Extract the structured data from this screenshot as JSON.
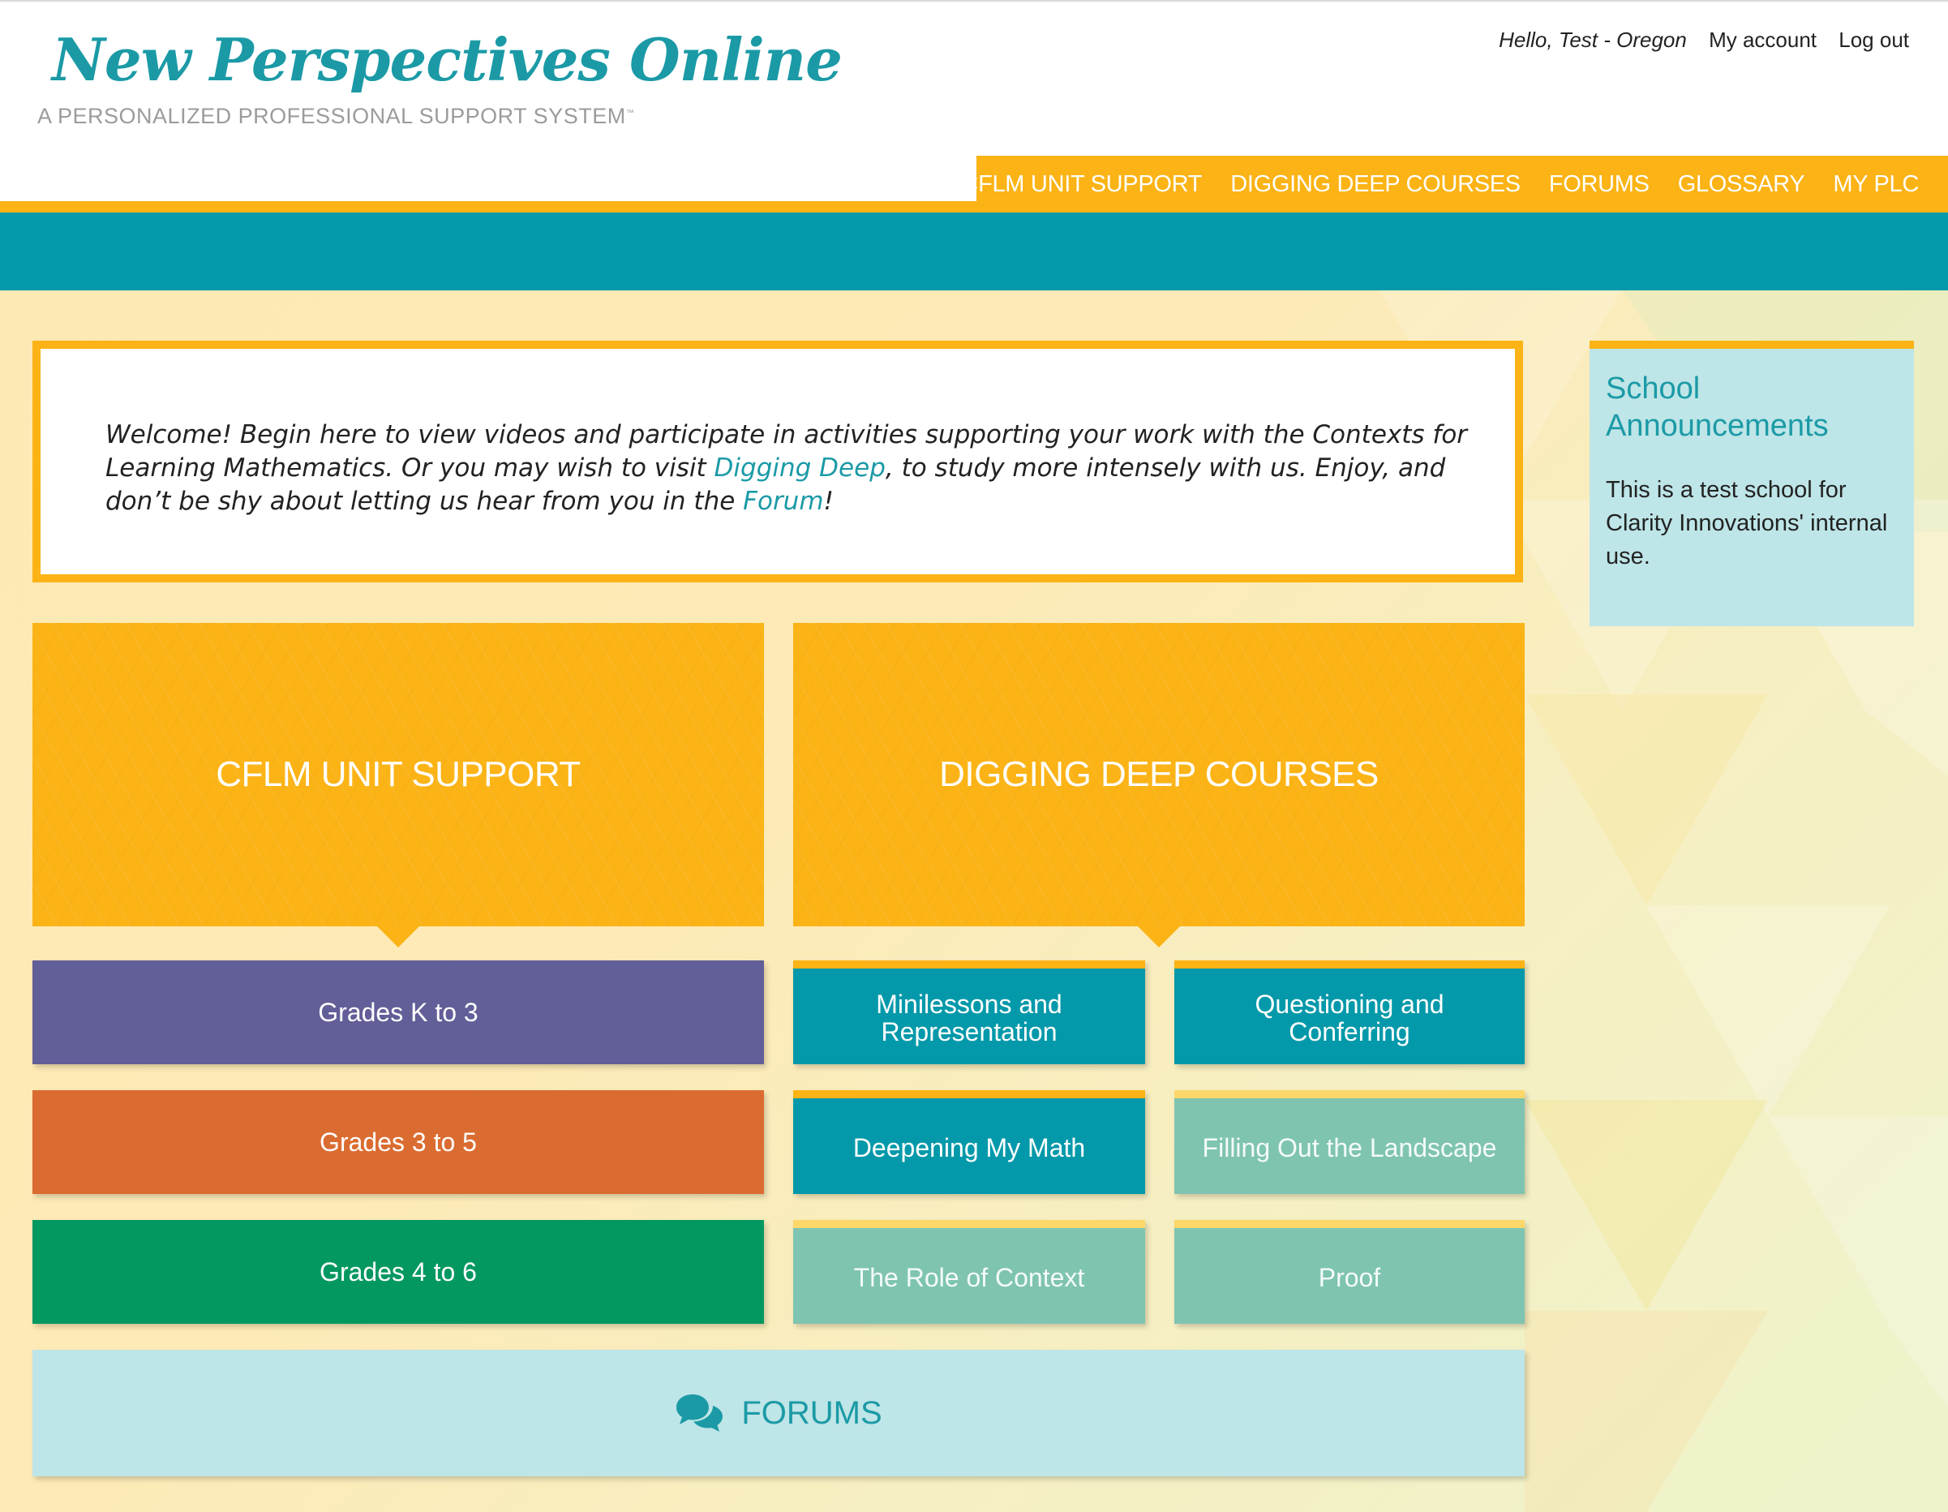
{
  "header": {
    "logo_title": "New Perspectives Online",
    "logo_subtitle": "A PERSONALIZED PROFESSIONAL SUPPORT SYSTEM",
    "logo_trademark": "™",
    "greeting": "Hello, Test - Oregon",
    "my_account": "My account",
    "log_out": "Log out"
  },
  "nav": {
    "items": [
      "CFLM UNIT SUPPORT",
      "DIGGING DEEP COURSES",
      "FORUMS",
      "GLOSSARY",
      "MY PLC"
    ]
  },
  "welcome": {
    "text_1": "Welcome! Begin here to view videos and participate in activities supporting your work with the Contexts for Learning Mathematics. Or you may wish to visit ",
    "link_1": "Digging Deep",
    "text_2": ", to study more intensely with us. Enjoy, and don’t be shy about letting us hear from you in the ",
    "link_2": "Forum",
    "text_3": "!"
  },
  "sections": {
    "cflm": {
      "title": "CFLM UNIT SUPPORT",
      "grades": [
        "Grades K to 3",
        "Grades 3 to 5",
        "Grades 4 to 6"
      ]
    },
    "digging_deep": {
      "title": "DIGGING DEEP COURSES",
      "courses": [
        "Minilessons and Representation",
        "Questioning and Conferring",
        "Deepening My Math",
        "Filling Out the Landscape",
        "The Role of Context",
        "Proof"
      ]
    }
  },
  "forums": {
    "label": "FORUMS",
    "icon": "chat-bubbles-icon"
  },
  "announcements": {
    "title": "School Announcements",
    "body": "This is a test school for Clarity Innovations' internal use."
  },
  "colors": {
    "gold": "#fbb315",
    "teal": "#0499aa",
    "purple": "#625e98",
    "orange": "#db6c31",
    "green": "#049861",
    "mint": "#7fc4b1",
    "light_blue": "#bee5e7"
  }
}
